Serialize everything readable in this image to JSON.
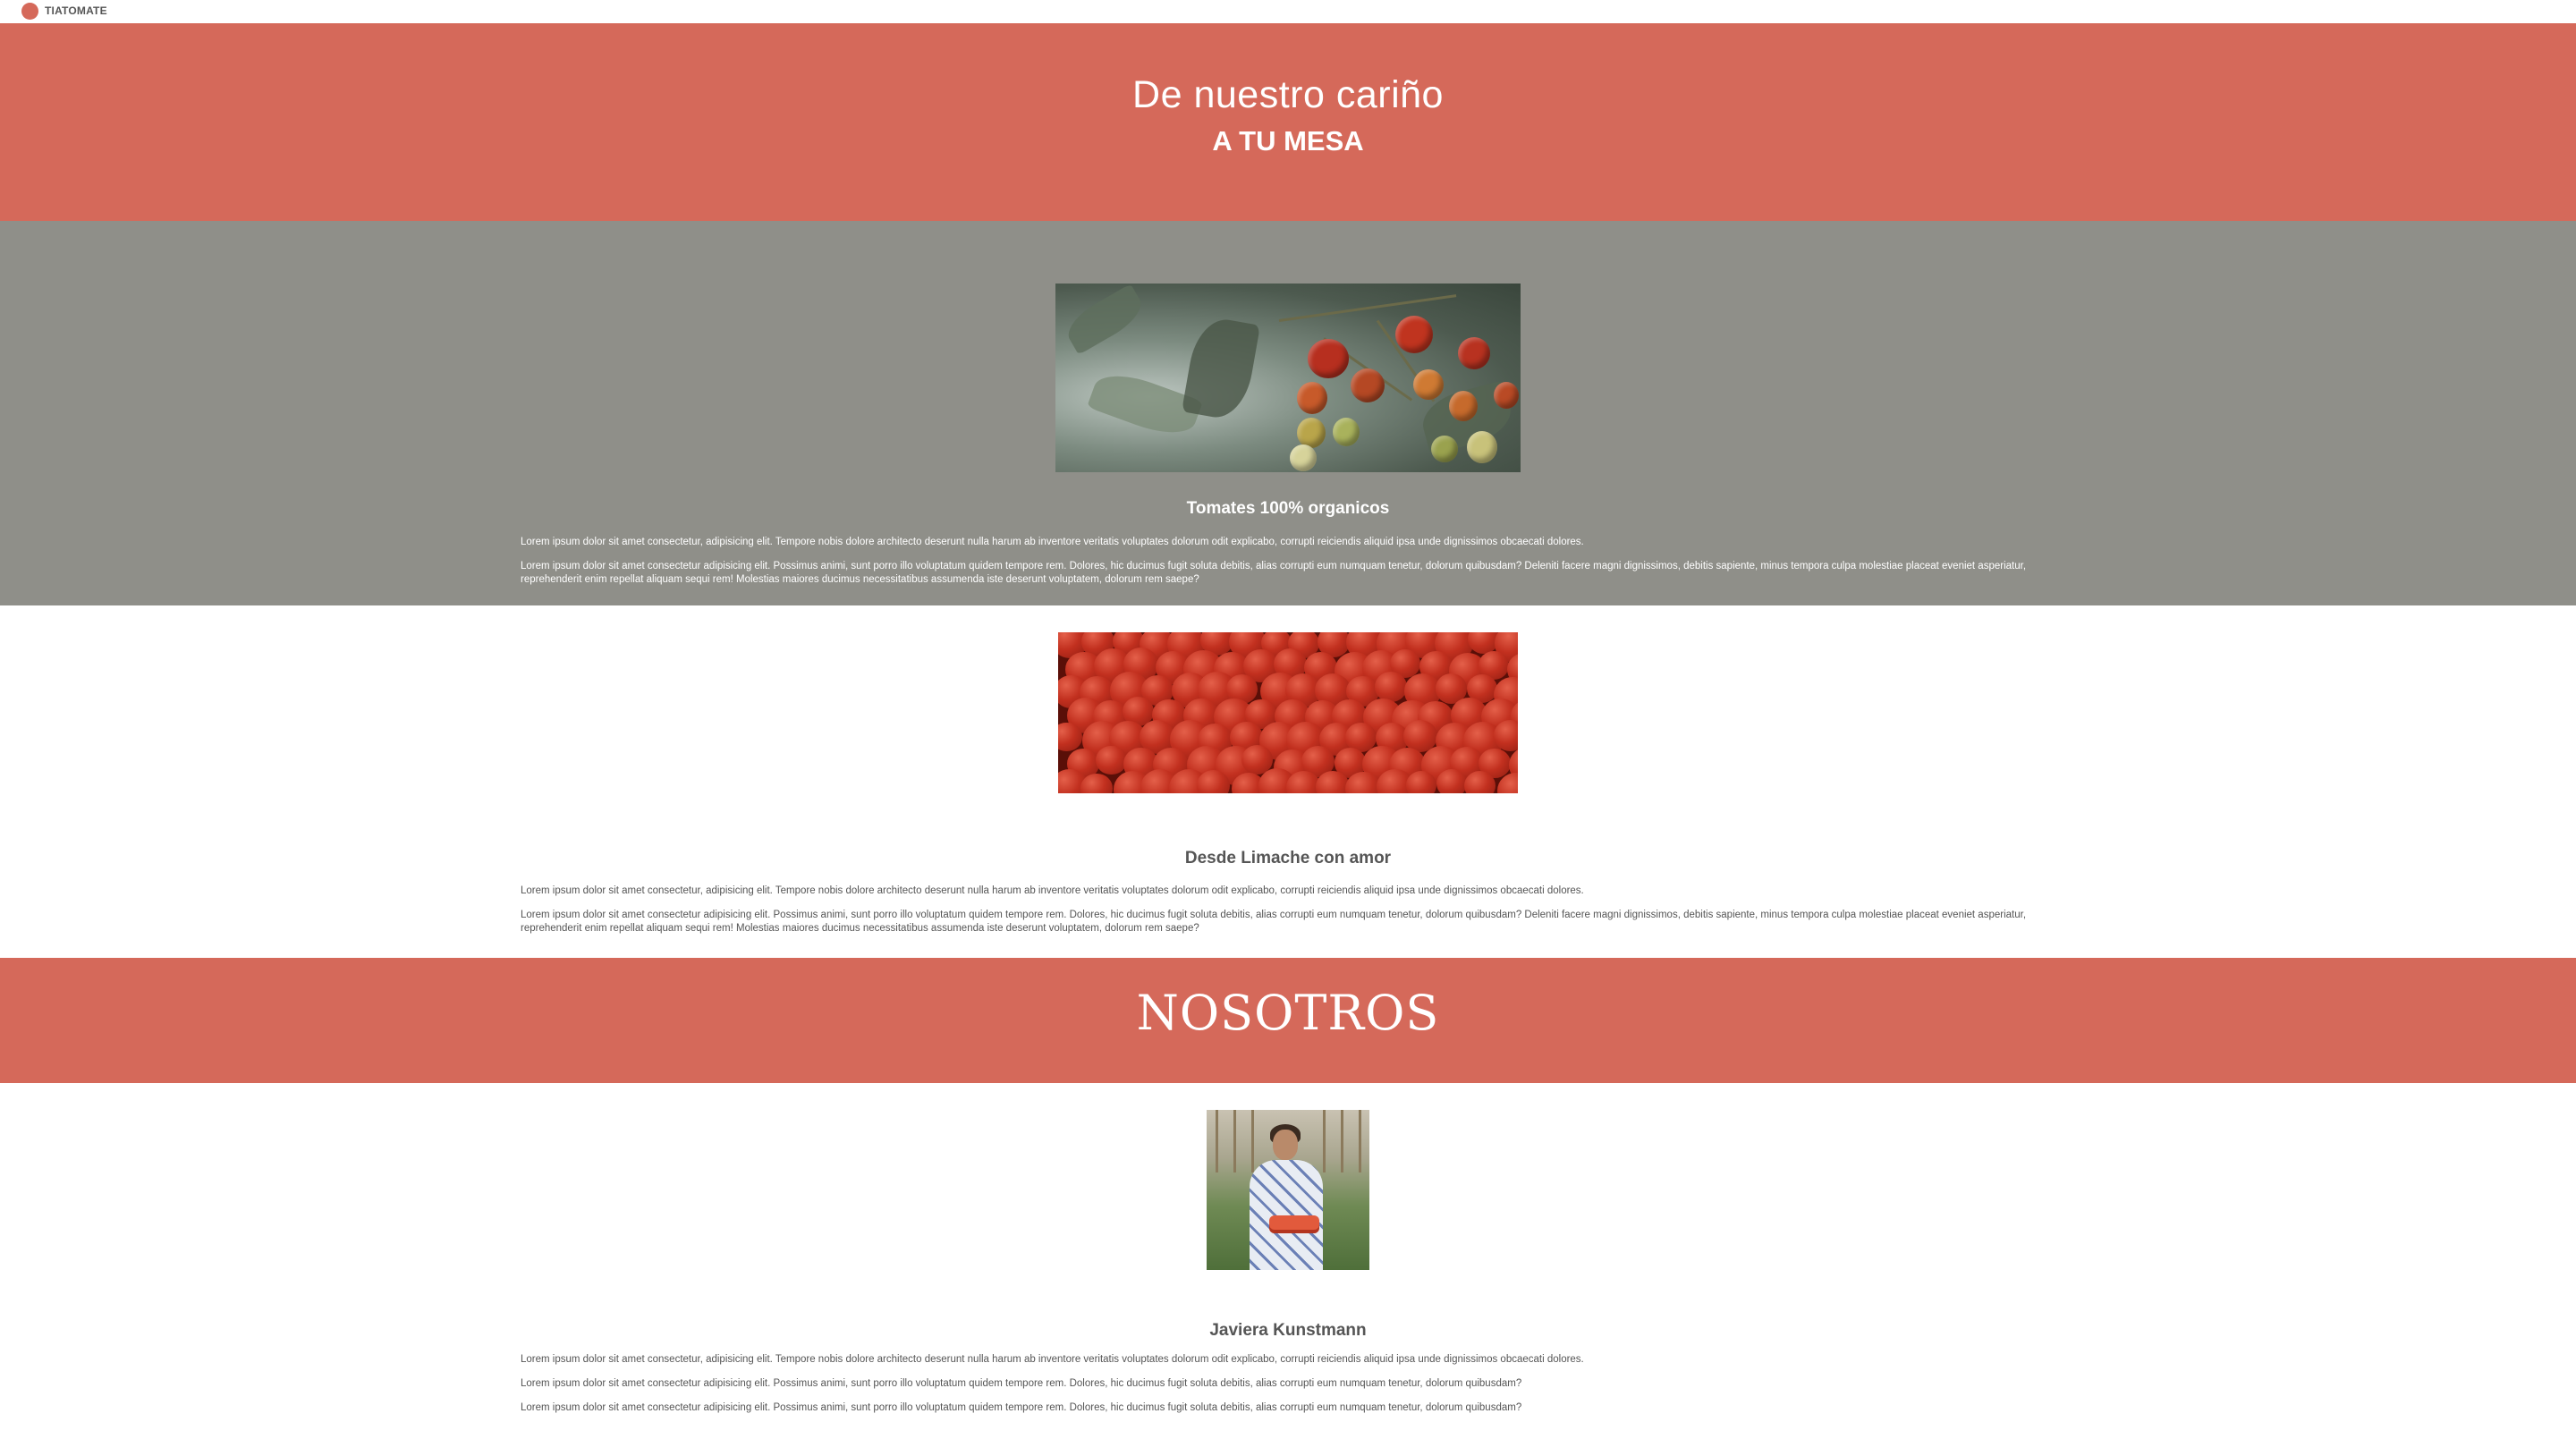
{
  "navbar": {
    "brand": "TIATOMATE",
    "logo_icon": "red-circle-logo",
    "colors": {
      "accent": "#d5695a"
    }
  },
  "hero": {
    "line1": "De nuestro cariño",
    "line2": "A TU MESA"
  },
  "feature1": {
    "image_alt": "tomatoes on the vine",
    "title": "Tomates 100% organicos",
    "paragraph1": "Lorem ipsum dolor sit amet consectetur, adipisicing elit. Tempore nobis dolore architecto deserunt nulla harum ab inventore veritatis voluptates dolorum odit explicabo, corrupti reiciendis aliquid ipsa unde dignissimos obcaecati dolores.",
    "paragraph2": "Lorem ipsum dolor sit amet consectetur adipisicing elit. Possimus animi, sunt porro illo voluptatum quidem tempore rem. Dolores, hic ducimus fugit soluta debitis, alias corrupti eum numquam tenetur, dolorum quibusdam? Deleniti facere magni dignissimos, debitis sapiente, minus tempora culpa molestiae placeat eveniet asperiatur, reprehenderit enim repellat aliquam sequi rem! Molestias maiores ducimus necessitatibus assumenda iste deserunt voluptatem, dolorum rem saepe?",
    "colors": {
      "background": "#8f8f89"
    }
  },
  "feature2": {
    "image_alt": "pile of red tomatoes",
    "title": "Desde Limache con amor",
    "paragraph1": "Lorem ipsum dolor sit amet consectetur, adipisicing elit. Tempore nobis dolore architecto deserunt nulla harum ab inventore veritatis voluptates dolorum odit explicabo, corrupti reiciendis aliquid ipsa unde dignissimos obcaecati dolores.",
    "paragraph2": "Lorem ipsum dolor sit amet consectetur adipisicing elit. Possimus animi, sunt porro illo voluptatum quidem tempore rem. Dolores, hic ducimus fugit soluta debitis, alias corrupti eum numquam tenetur, dolorum quibusdam? Deleniti facere magni dignissimos, debitis sapiente, minus tempora culpa molestiae placeat eveniet asperiatur, reprehenderit enim repellat aliquam sequi rem! Molestias maiores ducimus necessitatibus assumenda iste deserunt voluptatem, dolorum rem saepe?"
  },
  "about_banner": {
    "title": "NOSOTROS"
  },
  "about": {
    "image_alt": "woman holding tomatoes in greenhouse",
    "name": "Javiera Kunstmann",
    "paragraph1": "Lorem ipsum dolor sit amet consectetur, adipisicing elit. Tempore nobis dolore architecto deserunt nulla harum ab inventore veritatis voluptates dolorum odit explicabo, corrupti reiciendis aliquid ipsa unde dignissimos obcaecati dolores.",
    "paragraph2": "Lorem ipsum dolor sit amet consectetur adipisicing elit. Possimus animi, sunt porro illo voluptatum quidem tempore rem. Dolores, hic ducimus fugit soluta debitis, alias corrupti eum numquam tenetur, dolorum quibusdam?",
    "paragraph3": "Lorem ipsum dolor sit amet consectetur adipisicing elit. Possimus animi, sunt porro illo voluptatum quidem tempore rem. Dolores, hic ducimus fugit soluta debitis, alias corrupti eum numquam tenetur, dolorum quibusdam?"
  }
}
